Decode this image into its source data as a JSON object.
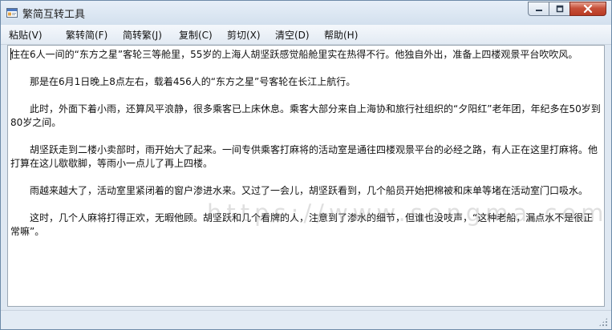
{
  "window": {
    "title": "繁简互转工具",
    "icon": "app-window-icon",
    "controls": [
      "minimize-icon",
      "maximize-icon",
      "close-icon"
    ]
  },
  "menu": {
    "items": [
      {
        "label": "粘贴(V)"
      },
      {
        "label": "繁转简(F)"
      },
      {
        "label": "简转繁(J)"
      },
      {
        "label": "复制(C)"
      },
      {
        "label": "剪切(X)"
      },
      {
        "label": "清空(D)"
      },
      {
        "label": "帮助(H)"
      }
    ]
  },
  "editor": {
    "paragraphs": [
      "住在6人一间的“东方之星”客轮三等舱里，55岁的上海人胡坚跃感觉船舱里实在热得不行。他独自外出，准备上四楼观景平台吹吹风。",
      "那是在6月1日晚上8点左右，载着456人的“东方之星”号客轮在长江上航行。",
      "此时，外面下着小雨，还算风平浪静，很多乘客已上床休息。乘客大部分来自上海协和旅行社组织的“夕阳红”老年团，年纪多在50岁到80岁之间。",
      "胡坚跃走到二楼小卖部时，雨开始大了起来。一间专供乘客打麻将的活动室是通往四楼观景平台的必经之路，有人正在这里打麻将。他打算在这儿歇歇脚，等雨小一点儿了再上四楼。",
      "雨越来越大了，活动室里紧闭着的窗户渗进水来。又过了一会儿，胡坚跃看到，几个船员开始把棉被和床单等堵在活动室门口吸水。",
      "这时，几个人麻将打得正欢，无暇他顾。胡坚跃和几个看牌的人，注意到了渗水的细节，但谁也没吱声，“这种老船，漏点水不是很正常嘛”。"
    ]
  },
  "watermark": "https://www.songma.com",
  "statusbar": {
    "grip_icon": "resize-grip-icon"
  }
}
